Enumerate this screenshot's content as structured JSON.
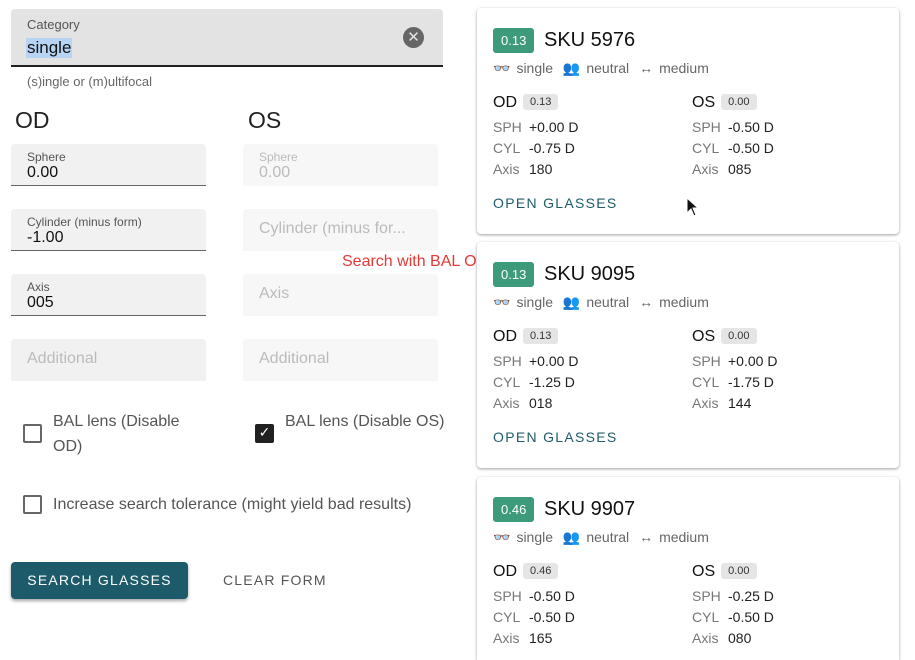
{
  "form": {
    "category": {
      "label": "Category",
      "value": "single",
      "helper": "(s)ingle or (m)ultifocal"
    },
    "od": {
      "title": "OD",
      "sphere": {
        "label": "Sphere",
        "value": "0.00"
      },
      "cylinder": {
        "label": "Cylinder (minus form)",
        "value": "-1.00"
      },
      "axis": {
        "label": "Axis",
        "value": "005"
      },
      "additional": {
        "placeholder": "Additional"
      },
      "bal": {
        "label": "BAL lens (Disable OD)",
        "checked": false
      }
    },
    "os": {
      "title": "OS",
      "sphere": {
        "label": "Sphere",
        "value": "0.00"
      },
      "cylinder": {
        "placeholder": "Cylinder (minus for..."
      },
      "axis": {
        "placeholder": "Axis"
      },
      "additional": {
        "placeholder": "Additional"
      },
      "bal": {
        "label": "BAL lens (Disable OS)",
        "checked": true
      }
    },
    "tolerance": {
      "label": "Increase search tolerance (might yield bad results)",
      "checked": false
    },
    "search_button": "SEARCH GLASSES",
    "clear_button": "CLEAR FORM"
  },
  "overlay_text": "Search with BAL OS",
  "results": [
    {
      "score": "0.13",
      "sku": "SKU 5976",
      "type": "single",
      "gender": "neutral",
      "size": "medium",
      "od": {
        "label": "OD",
        "score": "0.13",
        "sph": "+0.00 D",
        "cyl": "-0.75 D",
        "axis": "180"
      },
      "os": {
        "label": "OS",
        "score": "0.00",
        "sph": "-0.50 D",
        "cyl": "-0.50 D",
        "axis": "085"
      },
      "open": "OPEN GLASSES"
    },
    {
      "score": "0.13",
      "sku": "SKU 9095",
      "type": "single",
      "gender": "neutral",
      "size": "medium",
      "od": {
        "label": "OD",
        "score": "0.13",
        "sph": "+0.00 D",
        "cyl": "-1.25 D",
        "axis": "018"
      },
      "os": {
        "label": "OS",
        "score": "0.00",
        "sph": "+0.00 D",
        "cyl": "-1.75 D",
        "axis": "144"
      },
      "open": "OPEN GLASSES"
    },
    {
      "score": "0.46",
      "sku": "SKU 9907",
      "type": "single",
      "gender": "neutral",
      "size": "medium",
      "od": {
        "label": "OD",
        "score": "0.46",
        "sph": "-0.50 D",
        "cyl": "-0.50 D",
        "axis": "165"
      },
      "os": {
        "label": "OS",
        "score": "0.00",
        "sph": "-0.25 D",
        "cyl": "-0.50 D",
        "axis": "080"
      },
      "open": "OPEN GLASSES"
    }
  ],
  "labels": {
    "sph": "SPH",
    "cyl": "CYL",
    "axis": "Axis"
  },
  "colors": {
    "primary": "#1e5b6a",
    "score_badge": "#3d9a7a",
    "overlay": "#e53935"
  },
  "icons": {
    "type": "glasses-icon",
    "gender": "people-icon",
    "size": "width-arrows-icon",
    "clear": "close-circle-icon",
    "cursor": "mouse-pointer-icon"
  }
}
